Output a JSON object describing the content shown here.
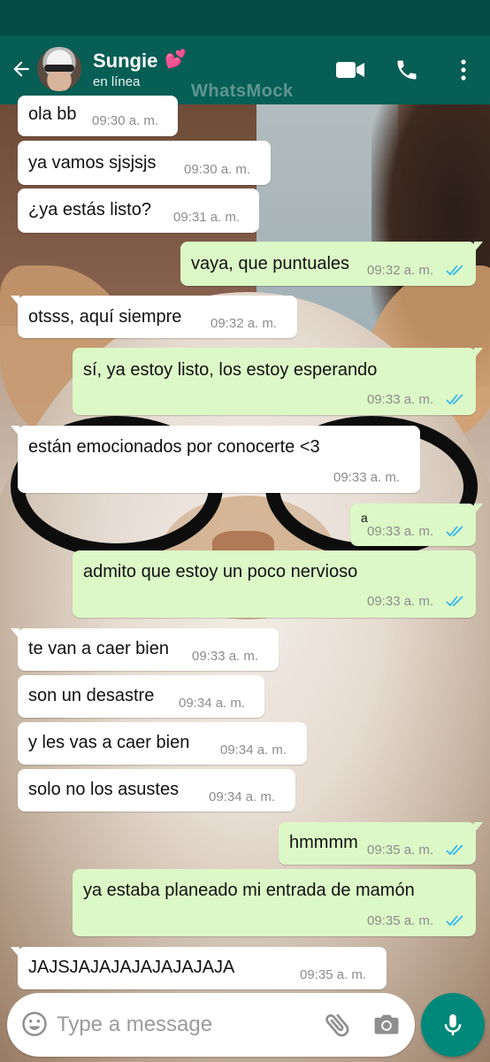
{
  "header": {
    "contact_name": "Sungie",
    "heart_emoji": "💕",
    "status": "en línea",
    "watermark": "WhatsMock",
    "icons": [
      "back-arrow-icon",
      "video-call-icon",
      "phone-icon",
      "more-vertical-icon"
    ]
  },
  "colors": {
    "header": "#075e54",
    "status_bar": "#054d44",
    "outgoing_bubble": "#dcf8c6",
    "incoming_bubble": "#ffffff",
    "read_ticks": "#34b7f1",
    "mic_button": "#00897b"
  },
  "messages": [
    {
      "direction": "in",
      "text": "ola bb",
      "time": "09:30 a. m."
    },
    {
      "direction": "in",
      "text": "ya vamos sjsjsjs",
      "time": "09:30 a. m."
    },
    {
      "direction": "in",
      "text": "¿ya estás listo?",
      "time": "09:31 a. m."
    },
    {
      "direction": "out",
      "text": "vaya, que puntuales",
      "time": "09:32 a. m.",
      "read": true
    },
    {
      "direction": "in",
      "text": "otsss, aquí siempre",
      "time": "09:32 a. m."
    },
    {
      "direction": "out",
      "text": "sí, ya estoy listo, los estoy esperando",
      "time": "09:33 a. m.",
      "read": true
    },
    {
      "direction": "in",
      "text": "están emocionados por conocerte <3",
      "time": "09:33 a. m."
    },
    {
      "direction": "out",
      "text": "a",
      "time": "09:33 a. m.",
      "read": true
    },
    {
      "direction": "out",
      "text": "admito que estoy un poco nervioso",
      "time": "09:33 a. m.",
      "read": true
    },
    {
      "direction": "in",
      "text": "te van a caer bien",
      "time": "09:33 a. m."
    },
    {
      "direction": "in",
      "text": "son un desastre",
      "time": "09:34 a. m."
    },
    {
      "direction": "in",
      "text": "y les vas a caer bien",
      "time": "09:34 a. m."
    },
    {
      "direction": "in",
      "text": "solo no los asustes",
      "time": "09:34 a. m."
    },
    {
      "direction": "out",
      "text": "hmmmm",
      "time": "09:35 a. m.",
      "read": true
    },
    {
      "direction": "out",
      "text": "ya estaba planeado mi entrada de mamón",
      "time": "09:35 a. m.",
      "read": true
    },
    {
      "direction": "in",
      "text": "JAJSJAJAJAJAJAJAJAJA",
      "time": "09:35 a. m."
    }
  ],
  "composer": {
    "placeholder": "Type a message",
    "value": "",
    "icons": [
      "emoji-icon",
      "attach-icon",
      "camera-icon",
      "mic-icon"
    ]
  }
}
